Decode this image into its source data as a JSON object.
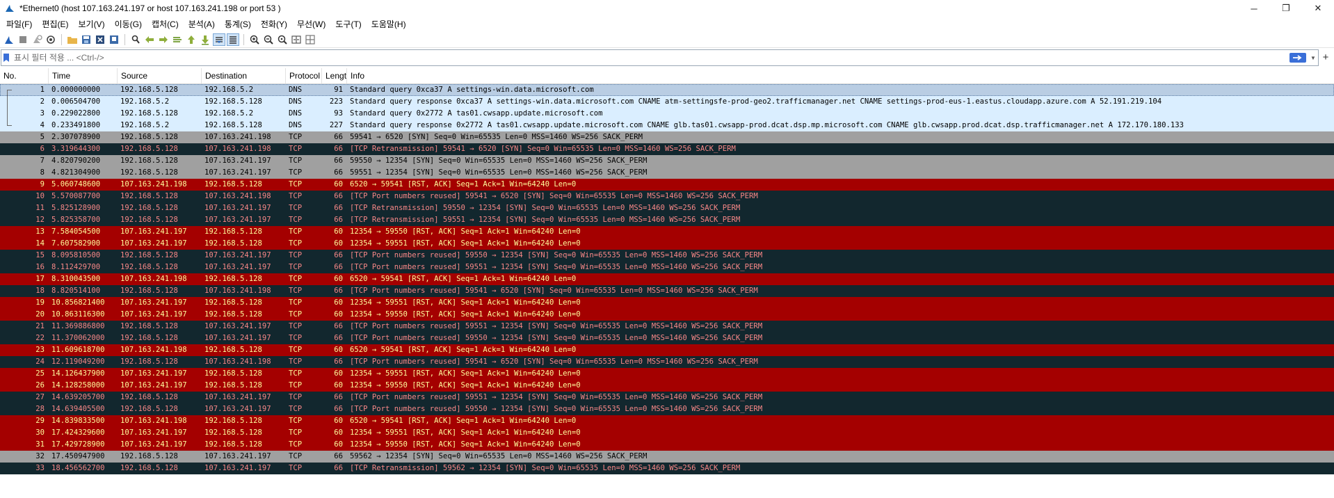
{
  "window": {
    "title": "*Ethernet0 (host 107.163.241.197 or host 107.163.241.198 or port 53 )",
    "minimize": "─",
    "restore": "❐",
    "close": "✕"
  },
  "menu": [
    "파일(F)",
    "편집(E)",
    "보기(V)",
    "이동(G)",
    "캡처(C)",
    "분석(A)",
    "통계(S)",
    "전화(Y)",
    "무선(W)",
    "도구(T)",
    "도움말(H)"
  ],
  "toolbar": {
    "icons": [
      "shark-start-icon",
      "stop-icon",
      "restart-icon",
      "capture-options-icon",
      "open-folder-icon",
      "save-icon",
      "close-file-icon",
      "reload-icon",
      "find-icon",
      "back-icon",
      "forward-icon",
      "go-to-packet-icon",
      "first-packet-icon",
      "last-packet-icon",
      "autoscroll-icon",
      "colorize-icon",
      "zoom-in-icon",
      "zoom-out-icon",
      "normal-size-icon",
      "resize-columns-icon",
      "layout-icon"
    ]
  },
  "filter": {
    "placeholder": "표시 필터 적용 ... <Ctrl-/>",
    "value": ""
  },
  "columns": [
    "No.",
    "Time",
    "Source",
    "Destination",
    "Protocol",
    "Lengt",
    "Info"
  ],
  "colors": {
    "selected_bg": "#b9cde3",
    "dns_bg": "#daeeff",
    "syn_bg": "#a0a0a0",
    "dark_bg": "#12272e",
    "dark_fg": "#f78787",
    "rst_bg": "#a40000",
    "rst_fg": "#fffc9c"
  },
  "packets": [
    {
      "no": "1",
      "time": "0.000000000",
      "src": "192.168.5.128",
      "dst": "192.168.5.2",
      "proto": "DNS",
      "len": "91",
      "info": "Standard query 0xca37 A settings-win.data.microsoft.com",
      "style": "selected"
    },
    {
      "no": "2",
      "time": "0.006504700",
      "src": "192.168.5.2",
      "dst": "192.168.5.128",
      "proto": "DNS",
      "len": "223",
      "info": "Standard query response 0xca37 A settings-win.data.microsoft.com CNAME atm-settingsfe-prod-geo2.trafficmanager.net CNAME settings-prod-eus-1.eastus.cloudapp.azure.com A 52.191.219.104",
      "style": "dns"
    },
    {
      "no": "3",
      "time": "0.229022800",
      "src": "192.168.5.128",
      "dst": "192.168.5.2",
      "proto": "DNS",
      "len": "93",
      "info": "Standard query 0x2772 A tas01.cwsapp.update.microsoft.com",
      "style": "dns"
    },
    {
      "no": "4",
      "time": "0.233491800",
      "src": "192.168.5.2",
      "dst": "192.168.5.128",
      "proto": "DNS",
      "len": "227",
      "info": "Standard query response 0x2772 A tas01.cwsapp.update.microsoft.com CNAME glb.tas01.cwsapp-prod.dcat.dsp.mp.microsoft.com CNAME glb.cwsapp.prod.dcat.dsp.trafficmanager.net A 172.170.180.133",
      "style": "dns"
    },
    {
      "no": "5",
      "time": "2.307078900",
      "src": "192.168.5.128",
      "dst": "107.163.241.198",
      "proto": "TCP",
      "len": "66",
      "info": "59541 → 6520 [SYN] Seq=0 Win=65535 Len=0 MSS=1460 WS=256 SACK_PERM",
      "style": "syn"
    },
    {
      "no": "6",
      "time": "3.319644300",
      "src": "192.168.5.128",
      "dst": "107.163.241.198",
      "proto": "TCP",
      "len": "66",
      "info": "[TCP Retransmission] 59541 → 6520 [SYN] Seq=0 Win=65535 Len=0 MSS=1460 WS=256 SACK_PERM",
      "style": "dark"
    },
    {
      "no": "7",
      "time": "4.820790200",
      "src": "192.168.5.128",
      "dst": "107.163.241.197",
      "proto": "TCP",
      "len": "66",
      "info": "59550 → 12354 [SYN] Seq=0 Win=65535 Len=0 MSS=1460 WS=256 SACK_PERM",
      "style": "syn"
    },
    {
      "no": "8",
      "time": "4.821304900",
      "src": "192.168.5.128",
      "dst": "107.163.241.197",
      "proto": "TCP",
      "len": "66",
      "info": "59551 → 12354 [SYN] Seq=0 Win=65535 Len=0 MSS=1460 WS=256 SACK_PERM",
      "style": "syn"
    },
    {
      "no": "9",
      "time": "5.060748600",
      "src": "107.163.241.198",
      "dst": "192.168.5.128",
      "proto": "TCP",
      "len": "60",
      "info": "6520 → 59541 [RST, ACK] Seq=1 Ack=1 Win=64240 Len=0",
      "style": "rst"
    },
    {
      "no": "10",
      "time": "5.570087700",
      "src": "192.168.5.128",
      "dst": "107.163.241.198",
      "proto": "TCP",
      "len": "66",
      "info": "[TCP Port numbers reused] 59541 → 6520 [SYN] Seq=0 Win=65535 Len=0 MSS=1460 WS=256 SACK_PERM",
      "style": "dark"
    },
    {
      "no": "11",
      "time": "5.825128900",
      "src": "192.168.5.128",
      "dst": "107.163.241.197",
      "proto": "TCP",
      "len": "66",
      "info": "[TCP Retransmission] 59550 → 12354 [SYN] Seq=0 Win=65535 Len=0 MSS=1460 WS=256 SACK_PERM",
      "style": "dark"
    },
    {
      "no": "12",
      "time": "5.825358700",
      "src": "192.168.5.128",
      "dst": "107.163.241.197",
      "proto": "TCP",
      "len": "66",
      "info": "[TCP Retransmission] 59551 → 12354 [SYN] Seq=0 Win=65535 Len=0 MSS=1460 WS=256 SACK_PERM",
      "style": "dark"
    },
    {
      "no": "13",
      "time": "7.584054500",
      "src": "107.163.241.197",
      "dst": "192.168.5.128",
      "proto": "TCP",
      "len": "60",
      "info": "12354 → 59550 [RST, ACK] Seq=1 Ack=1 Win=64240 Len=0",
      "style": "rst"
    },
    {
      "no": "14",
      "time": "7.607582900",
      "src": "107.163.241.197",
      "dst": "192.168.5.128",
      "proto": "TCP",
      "len": "60",
      "info": "12354 → 59551 [RST, ACK] Seq=1 Ack=1 Win=64240 Len=0",
      "style": "rst"
    },
    {
      "no": "15",
      "time": "8.095810500",
      "src": "192.168.5.128",
      "dst": "107.163.241.197",
      "proto": "TCP",
      "len": "66",
      "info": "[TCP Port numbers reused] 59550 → 12354 [SYN] Seq=0 Win=65535 Len=0 MSS=1460 WS=256 SACK_PERM",
      "style": "dark"
    },
    {
      "no": "16",
      "time": "8.112429700",
      "src": "192.168.5.128",
      "dst": "107.163.241.197",
      "proto": "TCP",
      "len": "66",
      "info": "[TCP Port numbers reused] 59551 → 12354 [SYN] Seq=0 Win=65535 Len=0 MSS=1460 WS=256 SACK_PERM",
      "style": "dark"
    },
    {
      "no": "17",
      "time": "8.310043500",
      "src": "107.163.241.198",
      "dst": "192.168.5.128",
      "proto": "TCP",
      "len": "60",
      "info": "6520 → 59541 [RST, ACK] Seq=1 Ack=1 Win=64240 Len=0",
      "style": "rst"
    },
    {
      "no": "18",
      "time": "8.820514100",
      "src": "192.168.5.128",
      "dst": "107.163.241.198",
      "proto": "TCP",
      "len": "66",
      "info": "[TCP Port numbers reused] 59541 → 6520 [SYN] Seq=0 Win=65535 Len=0 MSS=1460 WS=256 SACK_PERM",
      "style": "dark"
    },
    {
      "no": "19",
      "time": "10.856821400",
      "src": "107.163.241.197",
      "dst": "192.168.5.128",
      "proto": "TCP",
      "len": "60",
      "info": "12354 → 59551 [RST, ACK] Seq=1 Ack=1 Win=64240 Len=0",
      "style": "rst"
    },
    {
      "no": "20",
      "time": "10.863116300",
      "src": "107.163.241.197",
      "dst": "192.168.5.128",
      "proto": "TCP",
      "len": "60",
      "info": "12354 → 59550 [RST, ACK] Seq=1 Ack=1 Win=64240 Len=0",
      "style": "rst"
    },
    {
      "no": "21",
      "time": "11.369886800",
      "src": "192.168.5.128",
      "dst": "107.163.241.197",
      "proto": "TCP",
      "len": "66",
      "info": "[TCP Port numbers reused] 59551 → 12354 [SYN] Seq=0 Win=65535 Len=0 MSS=1460 WS=256 SACK_PERM",
      "style": "dark"
    },
    {
      "no": "22",
      "time": "11.370062000",
      "src": "192.168.5.128",
      "dst": "107.163.241.197",
      "proto": "TCP",
      "len": "66",
      "info": "[TCP Port numbers reused] 59550 → 12354 [SYN] Seq=0 Win=65535 Len=0 MSS=1460 WS=256 SACK_PERM",
      "style": "dark"
    },
    {
      "no": "23",
      "time": "11.609618700",
      "src": "107.163.241.198",
      "dst": "192.168.5.128",
      "proto": "TCP",
      "len": "60",
      "info": "6520 → 59541 [RST, ACK] Seq=1 Ack=1 Win=64240 Len=0",
      "style": "rst"
    },
    {
      "no": "24",
      "time": "12.119049200",
      "src": "192.168.5.128",
      "dst": "107.163.241.198",
      "proto": "TCP",
      "len": "66",
      "info": "[TCP Port numbers reused] 59541 → 6520 [SYN] Seq=0 Win=65535 Len=0 MSS=1460 WS=256 SACK_PERM",
      "style": "dark"
    },
    {
      "no": "25",
      "time": "14.126437900",
      "src": "107.163.241.197",
      "dst": "192.168.5.128",
      "proto": "TCP",
      "len": "60",
      "info": "12354 → 59551 [RST, ACK] Seq=1 Ack=1 Win=64240 Len=0",
      "style": "rst"
    },
    {
      "no": "26",
      "time": "14.128258000",
      "src": "107.163.241.197",
      "dst": "192.168.5.128",
      "proto": "TCP",
      "len": "60",
      "info": "12354 → 59550 [RST, ACK] Seq=1 Ack=1 Win=64240 Len=0",
      "style": "rst"
    },
    {
      "no": "27",
      "time": "14.639205700",
      "src": "192.168.5.128",
      "dst": "107.163.241.197",
      "proto": "TCP",
      "len": "66",
      "info": "[TCP Port numbers reused] 59551 → 12354 [SYN] Seq=0 Win=65535 Len=0 MSS=1460 WS=256 SACK_PERM",
      "style": "dark"
    },
    {
      "no": "28",
      "time": "14.639405500",
      "src": "192.168.5.128",
      "dst": "107.163.241.197",
      "proto": "TCP",
      "len": "66",
      "info": "[TCP Port numbers reused] 59550 → 12354 [SYN] Seq=0 Win=65535 Len=0 MSS=1460 WS=256 SACK_PERM",
      "style": "dark"
    },
    {
      "no": "29",
      "time": "14.839833500",
      "src": "107.163.241.198",
      "dst": "192.168.5.128",
      "proto": "TCP",
      "len": "60",
      "info": "6520 → 59541 [RST, ACK] Seq=1 Ack=1 Win=64240 Len=0",
      "style": "rst"
    },
    {
      "no": "30",
      "time": "17.424329600",
      "src": "107.163.241.197",
      "dst": "192.168.5.128",
      "proto": "TCP",
      "len": "60",
      "info": "12354 → 59551 [RST, ACK] Seq=1 Ack=1 Win=64240 Len=0",
      "style": "rst"
    },
    {
      "no": "31",
      "time": "17.429728900",
      "src": "107.163.241.197",
      "dst": "192.168.5.128",
      "proto": "TCP",
      "len": "60",
      "info": "12354 → 59550 [RST, ACK] Seq=1 Ack=1 Win=64240 Len=0",
      "style": "rst"
    },
    {
      "no": "32",
      "time": "17.450947900",
      "src": "192.168.5.128",
      "dst": "107.163.241.197",
      "proto": "TCP",
      "len": "66",
      "info": "59562 → 12354 [SYN] Seq=0 Win=65535 Len=0 MSS=1460 WS=256 SACK_PERM",
      "style": "syn"
    },
    {
      "no": "33",
      "time": "18.456562700",
      "src": "192.168.5.128",
      "dst": "107.163.241.197",
      "proto": "TCP",
      "len": "66",
      "info": "[TCP Retransmission] 59562 → 12354 [SYN] Seq=0 Win=65535 Len=0 MSS=1460 WS=256 SACK_PERM",
      "style": "dark"
    }
  ]
}
